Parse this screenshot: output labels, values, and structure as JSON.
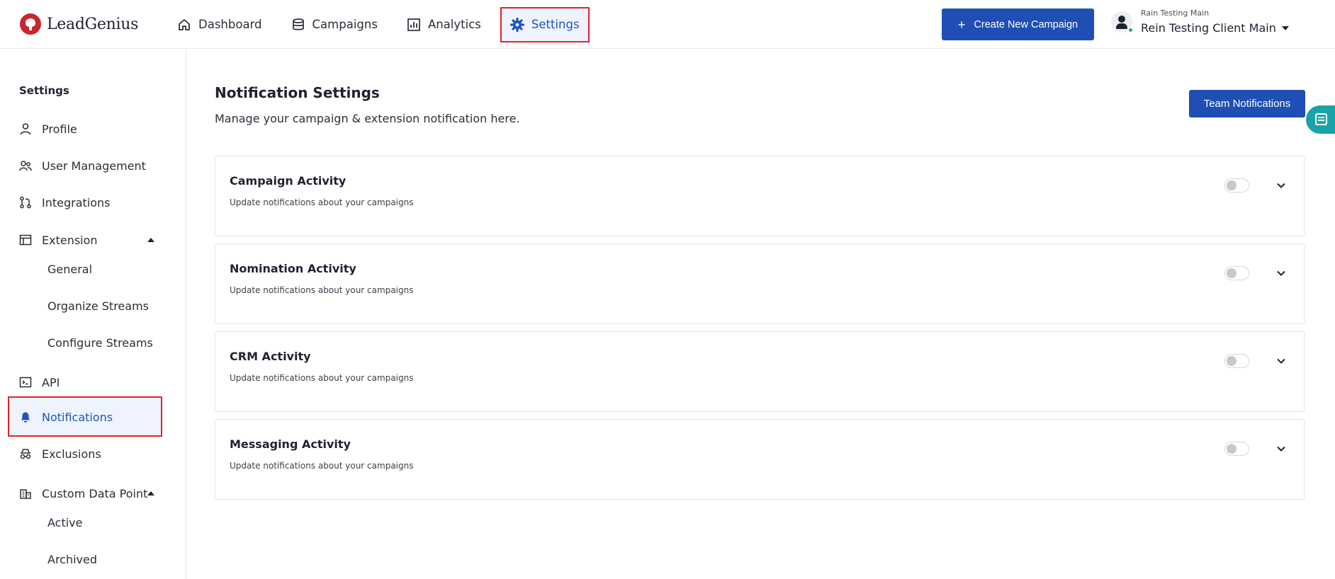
{
  "brand": {
    "name": "LeadGenius",
    "color": "#c8262d"
  },
  "nav": {
    "items": [
      {
        "label": "Dashboard",
        "icon": "home-icon"
      },
      {
        "label": "Campaigns",
        "icon": "database-icon"
      },
      {
        "label": "Analytics",
        "icon": "bar-chart-icon"
      },
      {
        "label": "Settings",
        "icon": "gear-icon",
        "active": true
      }
    ]
  },
  "header": {
    "create_button": "Create New Campaign",
    "user_org": "Rain Testing Main",
    "user_name": "Rein Testing Client Main"
  },
  "sidebar": {
    "heading": "Settings",
    "items": [
      {
        "label": "Profile",
        "icon": "user-icon"
      },
      {
        "label": "User Management",
        "icon": "users-icon"
      },
      {
        "label": "Integrations",
        "icon": "git-merge-icon"
      },
      {
        "label": "Extension",
        "icon": "browser-window-icon",
        "expanded": true
      },
      {
        "label": "General"
      },
      {
        "label": "Organize Streams"
      },
      {
        "label": "Configure Streams"
      },
      {
        "label": "API",
        "icon": "terminal-icon"
      },
      {
        "label": "Notifications",
        "icon": "bell-icon",
        "active": true
      },
      {
        "label": "Exclusions",
        "icon": "incognito-icon"
      },
      {
        "label": "Custom Data Point",
        "icon": "building-icon",
        "expanded": true
      },
      {
        "label": "Active"
      },
      {
        "label": "Archived"
      }
    ]
  },
  "main": {
    "title": "Notification Settings",
    "subtitle": "Manage your campaign & extension notification here.",
    "team_button": "Team Notifications",
    "cards": [
      {
        "title": "Campaign Activity",
        "description": "Update notifications about your campaigns",
        "enabled": false
      },
      {
        "title": "Nomination Activity",
        "description": "Update notifications about your campaigns",
        "enabled": false
      },
      {
        "title": "CRM Activity",
        "description": "Update notifications about your campaigns",
        "enabled": false
      },
      {
        "title": "Messaging Activity",
        "description": "Update notifications about your campaigns",
        "enabled": false
      }
    ]
  },
  "colors": {
    "primary": "#1f4fb5",
    "highlight": "#e52127",
    "active_bg": "#eef3fd",
    "chat": "#1aa3a8"
  }
}
